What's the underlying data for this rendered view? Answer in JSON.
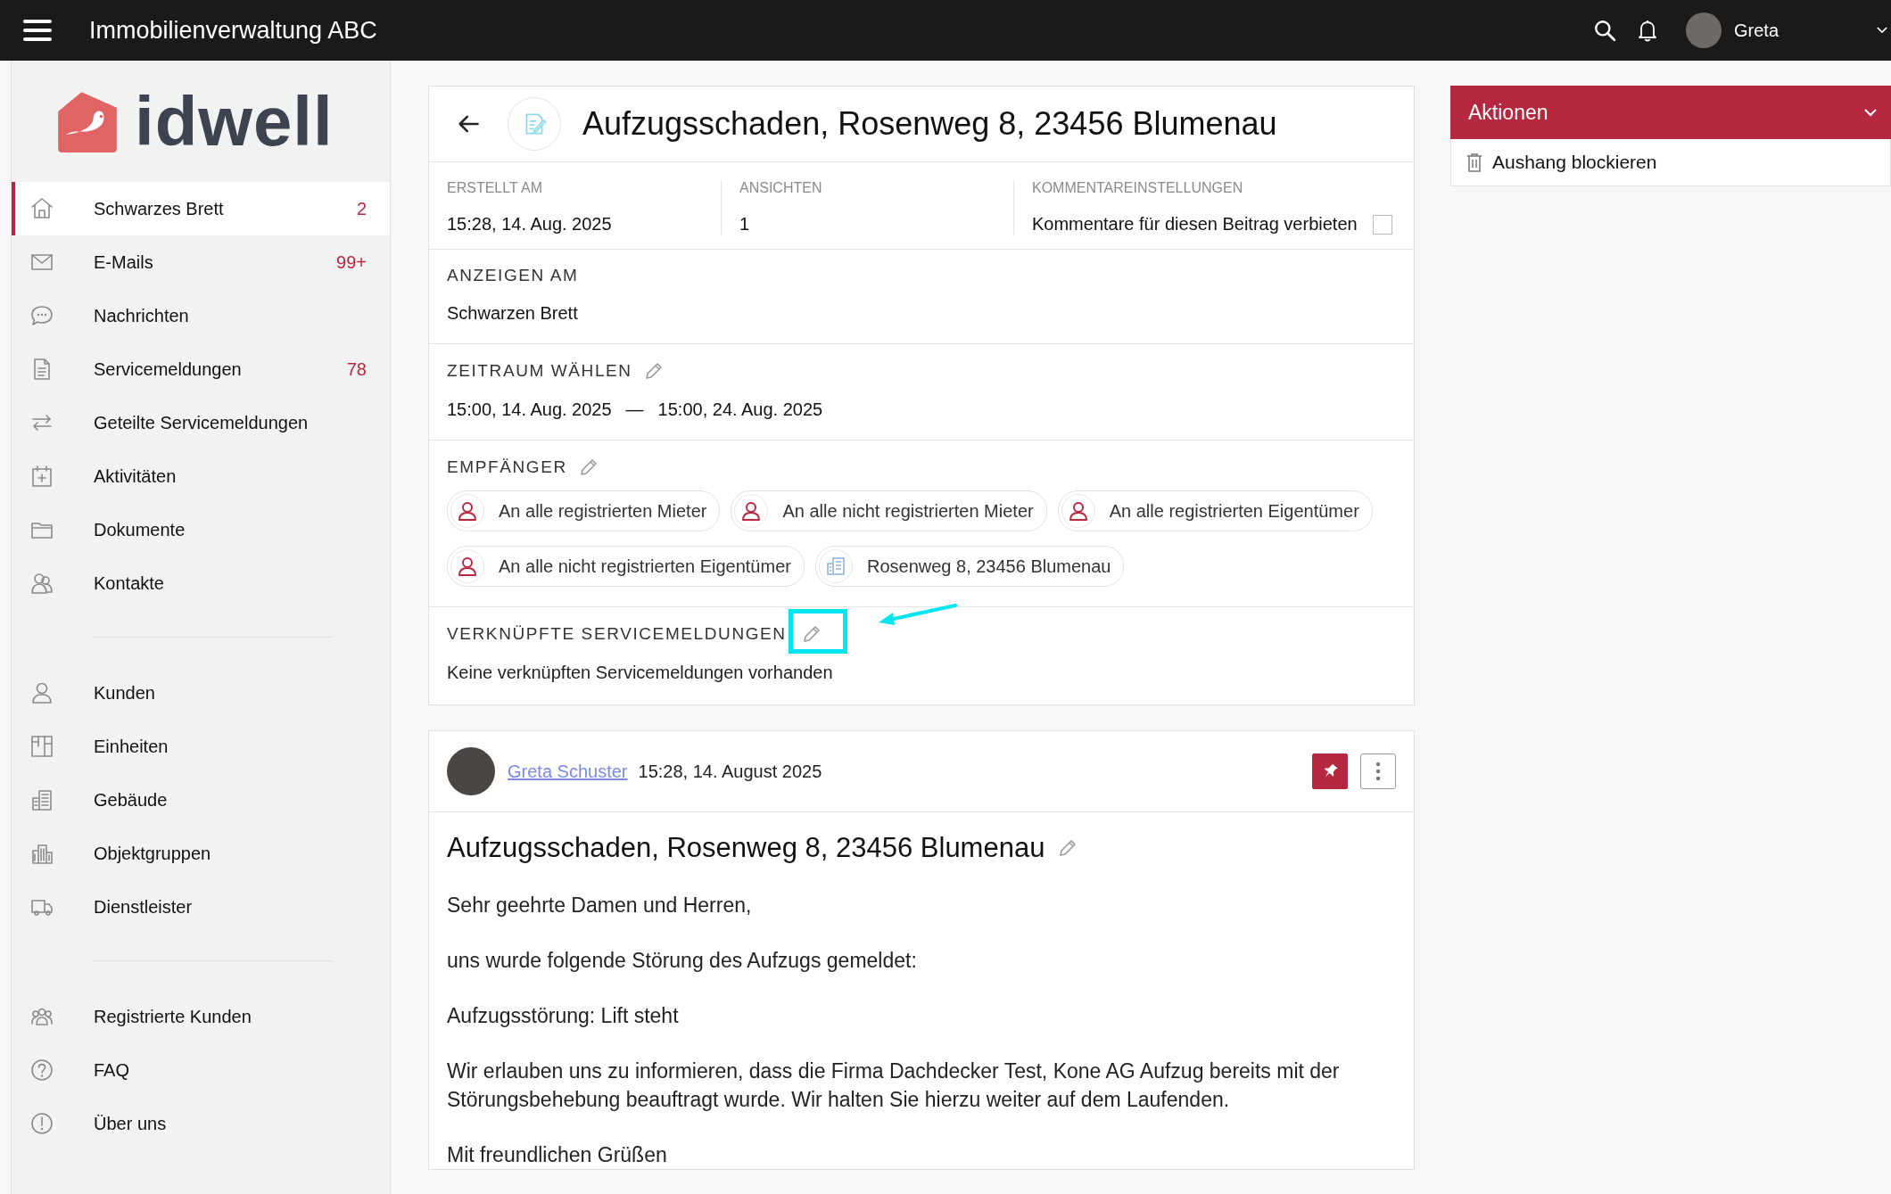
{
  "top_bar": {
    "title": "Immobilienverwaltung ABC",
    "user_name": "Greta"
  },
  "sidebar": {
    "logo_text": "idwell",
    "groups": [
      {
        "items": [
          {
            "label": "Schwarzes Brett",
            "badge": "2",
            "selected": true
          },
          {
            "label": "E-Mails",
            "badge": "99+",
            "selected": false
          },
          {
            "label": "Nachrichten",
            "selected": false
          },
          {
            "label": "Servicemeldungen",
            "badge": "78",
            "selected": false
          },
          {
            "label": "Geteilte Servicemeldungen",
            "selected": false
          },
          {
            "label": "Aktivitäten",
            "selected": false
          },
          {
            "label": "Dokumente",
            "selected": false
          },
          {
            "label": "Kontakte",
            "selected": false
          }
        ]
      },
      {
        "items": [
          {
            "label": "Kunden",
            "selected": false
          },
          {
            "label": "Einheiten",
            "selected": false
          },
          {
            "label": "Gebäude",
            "selected": false
          },
          {
            "label": "Objektgruppen",
            "selected": false
          },
          {
            "label": "Dienstleister",
            "selected": false
          }
        ]
      },
      {
        "items": [
          {
            "label": "Registrierte Kunden",
            "selected": false
          },
          {
            "label": "FAQ",
            "selected": false
          },
          {
            "label": "Über uns",
            "selected": false
          }
        ]
      }
    ]
  },
  "post": {
    "title": "Aufzugsschaden, Rosenweg 8, 23456 Blumenau",
    "meta": [
      {
        "label": "ERSTELLT AM",
        "value": "15:28, 14. Aug. 2025"
      },
      {
        "label": "ANSICHTEN",
        "value": "1"
      }
    ],
    "comment_settings": {
      "label": "KOMMENTAREINSTELLUNGEN",
      "option": "Kommentare für diesen Beitrag verbieten",
      "checked": false
    },
    "display_on": {
      "label": "ANZEIGEN AM",
      "value": "Schwarzen Brett"
    },
    "period": {
      "label": "ZEITRAUM WÄHLEN",
      "start": "15:00, 14. Aug. 2025",
      "separator": "—",
      "end": "15:00, 24. Aug. 2025"
    },
    "recipients": {
      "label": "EMPFÄNGER",
      "items": [
        {
          "kind": "person",
          "label": "An alle registrierten Mieter"
        },
        {
          "kind": "person",
          "label": "An alle nicht registrierten Mieter"
        },
        {
          "kind": "person",
          "label": "An alle registrierten Eigentümer"
        },
        {
          "kind": "person",
          "label": "An alle nicht registrierten Eigentümer"
        },
        {
          "kind": "building",
          "label": "Rosenweg 8, 23456 Blumenau"
        }
      ]
    },
    "linked": {
      "label": "VERKNÜPFTE SERVICEMELDUNGEN",
      "empty_text": "Keine verknüpften Servicemeldungen vorhanden"
    }
  },
  "post_view": {
    "author": "Greta Schuster",
    "time": "15:28, 14. August 2025",
    "pinned": true,
    "title": "Aufzugsschaden, Rosenweg 8, 23456 Blumenau",
    "paragraphs": [
      "Sehr geehrte Damen und Herren,",
      "uns wurde folgende Störung des Aufzugs gemeldet:",
      "Aufzugsstörung: Lift steht",
      "Wir erlauben uns zu informieren, dass die Firma Dachdecker Test, Kone AG Aufzug bereits mit der Störungsbehebung beauftragt wurde. Wir halten Sie hierzu weiter auf dem Laufenden.",
      "Mit freundlichen Grüßen"
    ]
  },
  "actions": {
    "title": "Aktionen",
    "items": [
      "Aushang blockieren"
    ]
  }
}
